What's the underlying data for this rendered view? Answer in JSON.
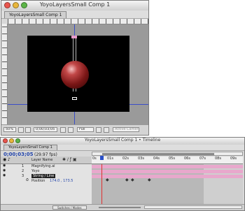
{
  "comp_window": {
    "title": "YoyoLayersSmall Comp 1",
    "tab_label": "YoyoLayersSmall Comp 1",
    "zoom": "50%",
    "timecode": "0;00;03;05",
    "resolution": "Full",
    "camera": "Active Camera"
  },
  "timeline_window": {
    "title": "YoyoLayersSmall Comp 1 • Timeline",
    "tab_label": "YoyoLayersSmall Comp 1",
    "timecode": "0;00;03;05",
    "fps": "(29.97 fps)",
    "columns": {
      "layer_name": "Layer Name"
    },
    "layers": [
      {
        "num": "1",
        "name": "Magnifying.ai"
      },
      {
        "num": "2",
        "name": "Yoyo"
      },
      {
        "num": "3",
        "name": "String / Line",
        "selected": true
      },
      {
        "num": "",
        "name": "Position"
      }
    ],
    "ruler_labels": [
      "0s",
      "01s",
      "02s",
      "03s",
      "04s",
      "05s",
      "06s",
      "07s",
      "08s",
      "09s"
    ],
    "footer": "Switches / Modes"
  },
  "colors": {
    "layer_bar": "#e8a8cc",
    "playhead": "#e03030",
    "comp_background": "#000000",
    "pasteboard": "#9a9a9a"
  }
}
